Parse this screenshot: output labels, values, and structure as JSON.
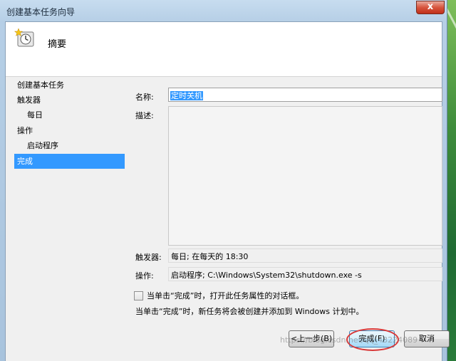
{
  "window": {
    "title": "创建基本任务向导",
    "close_glyph": "x"
  },
  "header": {
    "title": "摘要",
    "icon": "task-clock-icon"
  },
  "steps": [
    {
      "label": "创建基本任务",
      "active": false
    },
    {
      "label": "触发器",
      "active": false
    },
    {
      "label": "每日",
      "active": false
    },
    {
      "label": "操作",
      "active": false
    },
    {
      "label": "启动程序",
      "active": false
    },
    {
      "label": "完成",
      "active": true
    }
  ],
  "form": {
    "name_label": "名称:",
    "name_value": "定时关机",
    "desc_label": "描述:",
    "trigger_label": "触发器:",
    "trigger_value": "每日; 在每天的 18:30",
    "action_label": "操作:",
    "action_value": "启动程序; C:\\Windows\\System32\\shutdown.exe -s"
  },
  "options": {
    "open_props_label": "当单击“完成”时，打开此任务属性的对话框。",
    "open_props_checked": false,
    "note": "当单击“完成”时，新任务将会被创建并添加到 Windows 计划中。"
  },
  "buttons": {
    "back": "<上一步(B)",
    "finish": "完成(F)",
    "cancel": "取消"
  },
  "watermark": "https://blog.csdn.net/qq_43224089",
  "colors": {
    "selection": "#3399ff",
    "highlight_ring": "#d83a3a"
  }
}
